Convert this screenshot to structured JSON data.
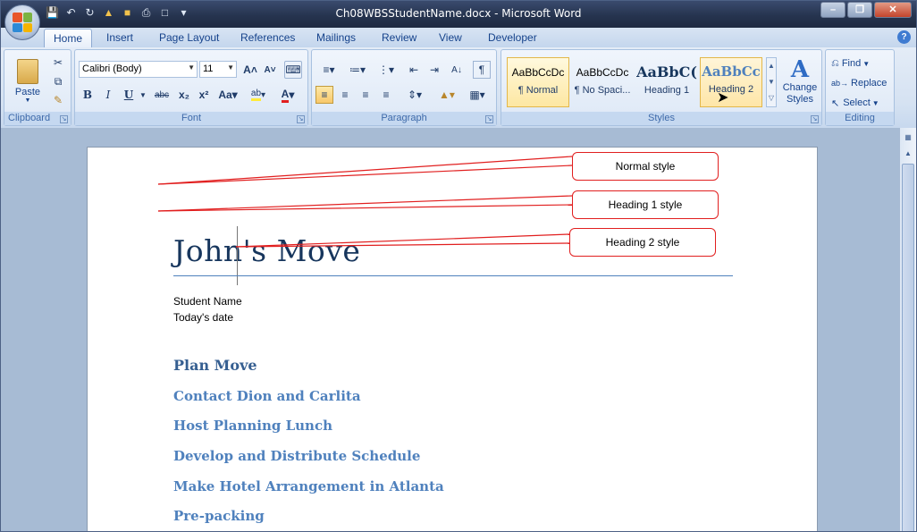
{
  "window": {
    "title": "Ch08WBSStudentName.docx - Microsoft Word",
    "controls": [
      "minimize",
      "restore",
      "close"
    ]
  },
  "quick_access": [
    "save-icon",
    "undo-icon",
    "redo-icon",
    "open-icon",
    "folder-icon",
    "print-icon",
    "new-icon",
    "customize-icon"
  ],
  "tabs": [
    "Home",
    "Insert",
    "Page Layout",
    "References",
    "Mailings",
    "Review",
    "View",
    "Developer"
  ],
  "active_tab": "Home",
  "ribbon": {
    "clipboard": {
      "label": "Clipboard",
      "paste": "Paste"
    },
    "font": {
      "label": "Font",
      "font_name": "Calibri (Body)",
      "font_size": "11"
    },
    "paragraph": {
      "label": "Paragraph"
    },
    "styles": {
      "label": "Styles",
      "gallery": [
        {
          "sample": "AaBbCcDc",
          "name": "¶ Normal"
        },
        {
          "sample": "AaBbCcDc",
          "name": "¶ No Spaci..."
        },
        {
          "sample": "AaBbC(",
          "name": "Heading 1"
        },
        {
          "sample": "AaBbCc",
          "name": "Heading 2"
        }
      ],
      "change_styles": "Change Styles"
    },
    "editing": {
      "label": "Editing",
      "find": "Find",
      "replace": "Replace",
      "select": "Select"
    }
  },
  "document": {
    "title": "John's Move",
    "line1": "Student Name",
    "line2": "Today's date",
    "heading1": "Plan Move",
    "headings2": [
      "Contact Dion and Carlita",
      "Host Planning  Lunch",
      "Develop and Distribute  Schedule",
      "Make Hotel Arrangement  in Atlanta",
      "Pre-packing"
    ]
  },
  "callouts": [
    "Normal style",
    "Heading 1 style",
    "Heading 2 style"
  ],
  "colors": {
    "callout_line": "#e11f1f",
    "heading1": "#365f91",
    "heading2": "#4f81bd",
    "title": "#17365d"
  }
}
